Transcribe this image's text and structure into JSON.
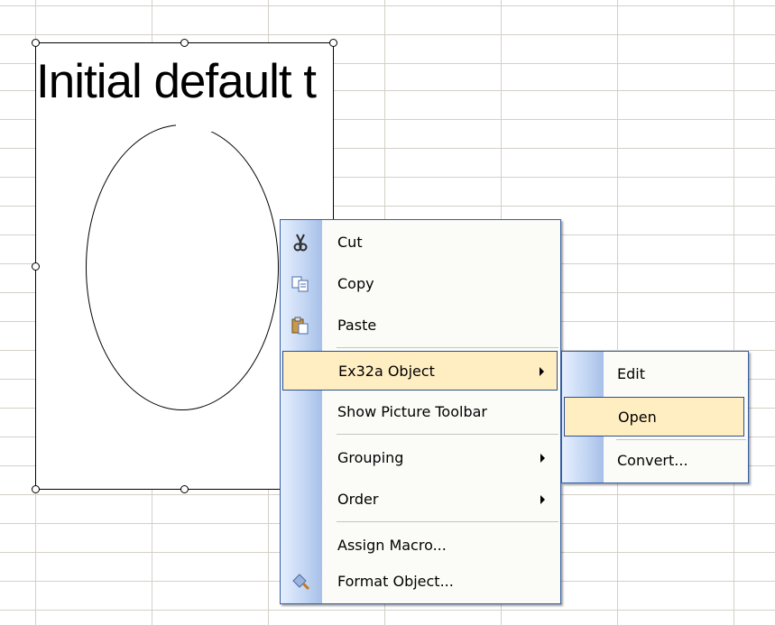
{
  "object": {
    "text": "Initial default t"
  },
  "context_menu": {
    "items": [
      {
        "label": "Cut",
        "icon": "scissors-icon"
      },
      {
        "label": "Copy",
        "icon": "copy-icon"
      },
      {
        "label": "Paste",
        "icon": "paste-icon"
      },
      {
        "label": "Ex32a Object",
        "has_submenu": true,
        "highlighted": true
      },
      {
        "label": "Show Picture Toolbar"
      },
      {
        "label": "Grouping",
        "has_submenu": true
      },
      {
        "label": "Order",
        "has_submenu": true
      },
      {
        "label": "Assign Macro..."
      },
      {
        "label": "Format Object...",
        "icon": "format-object-icon"
      }
    ]
  },
  "submenu": {
    "items": [
      {
        "label": "Edit"
      },
      {
        "label": "Open",
        "highlighted": true
      },
      {
        "label": "Convert..."
      }
    ]
  },
  "colors": {
    "highlight_fill": "#ffeec2",
    "highlight_border": "#2c4f91",
    "menu_border": "#355fa3",
    "gridline": "#d4d0c8"
  }
}
